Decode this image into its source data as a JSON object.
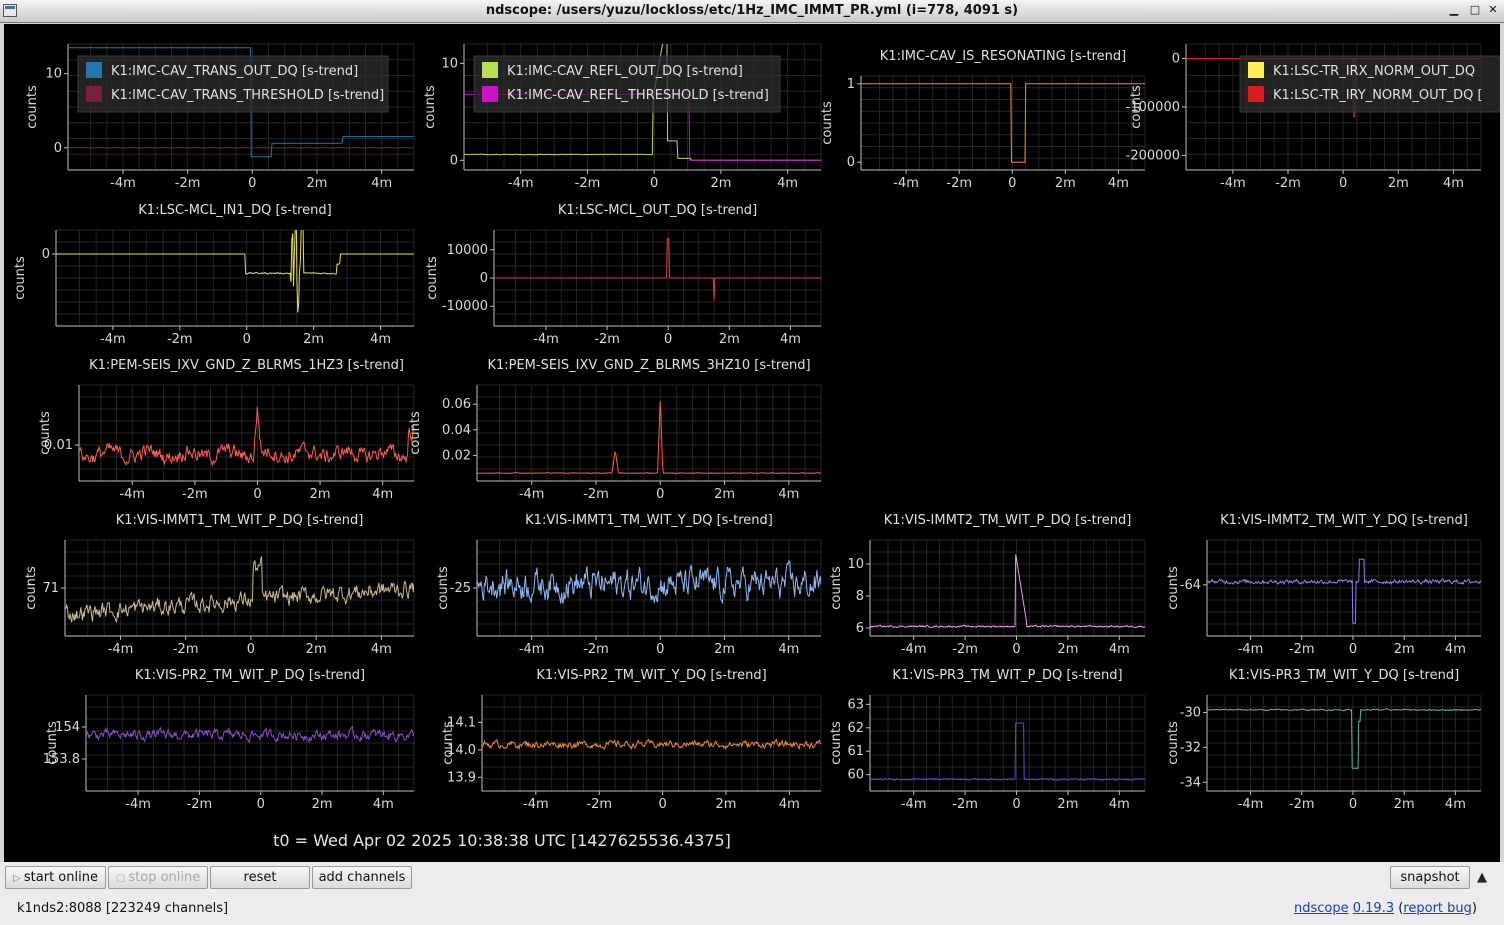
{
  "window": {
    "title": "ndscope: /users/yuzu/lockloss/etc/1Hz_IMC_IMMT_PR.yml (i=778, 4091 s)"
  },
  "t0_label": "t0 = Wed Apr 02 2025 10:38:38 UTC [1427625536.4375]",
  "toolbar": {
    "start_online": "start online",
    "stop_online": "stop online",
    "reset": "reset",
    "add_channels": "add channels",
    "snapshot": "snapshot"
  },
  "status": {
    "server": "k1nds2:8088   [223249 channels]",
    "app": "ndscope",
    "version": "0.19.3",
    "open": "(",
    "report": "report bug",
    "close": ")"
  },
  "x_ticks": [
    "-4m",
    "-2m",
    "0",
    "2m",
    "4m"
  ],
  "y_label": "counts",
  "plots": [
    {
      "id": "p00",
      "title": "",
      "ylim": [
        -3,
        14
      ],
      "yticks": [
        {
          "v": 0,
          "l": "0"
        },
        {
          "v": 10,
          "l": "10"
        }
      ],
      "legend": [
        {
          "label": "K1:IMC-CAV_TRANS_OUT_DQ [s-trend]",
          "color": "#1f77b4"
        },
        {
          "label": "K1:IMC-CAV_TRANS_THRESHOLD [s-trend]",
          "color": "#7b1e43"
        }
      ]
    },
    {
      "id": "p01",
      "title": "",
      "ylim": [
        -1,
        12
      ],
      "yticks": [
        {
          "v": 0,
          "l": "0"
        },
        {
          "v": 10,
          "l": "10"
        }
      ],
      "legend": [
        {
          "label": "K1:IMC-CAV_REFL_OUT_DQ [s-trend]",
          "color": "#b5e051"
        },
        {
          "label": "K1:IMC-CAV_REFL_THRESHOLD [s-trend]",
          "color": "#cc11cc"
        }
      ]
    },
    {
      "id": "p02",
      "title": "K1:IMC-CAV_IS_RESONATING [s-trend]",
      "ylim": [
        -0.1,
        1.1
      ],
      "yticks": [
        {
          "v": 0,
          "l": "0"
        },
        {
          "v": 1,
          "l": "1"
        }
      ],
      "legend": []
    },
    {
      "id": "p03",
      "title": "",
      "ylim": [
        -230000,
        30000
      ],
      "yticks": [
        {
          "v": 0,
          "l": "0"
        },
        {
          "v": -100000,
          "l": "-100000"
        },
        {
          "v": -200000,
          "l": "-200000"
        }
      ],
      "legend": [
        {
          "label": "K1:LSC-TR_IRX_NORM_OUT_DQ",
          "color": "#ffee55"
        },
        {
          "label": "K1:LSC-TR_IRY_NORM_OUT_DQ [",
          "color": "#e0191f"
        }
      ]
    },
    {
      "id": "p10",
      "title": "K1:LSC-MCL_IN1_DQ [s-trend]",
      "ylim": [
        -3,
        1
      ],
      "yticks": [
        {
          "v": 0,
          "l": "0"
        }
      ],
      "legend": []
    },
    {
      "id": "p11",
      "title": "K1:LSC-MCL_OUT_DQ [s-trend]",
      "ylim": [
        -17000,
        17000
      ],
      "yticks": [
        {
          "v": 10000,
          "l": "10000"
        },
        {
          "v": 0,
          "l": "0"
        },
        {
          "v": -10000,
          "l": "-10000"
        }
      ],
      "legend": []
    },
    {
      "id": "p20",
      "title": "K1:PEM-SEIS_IXV_GND_Z_BLRMS_1HZ3 [s-trend]",
      "ylim": [
        0.004,
        0.02
      ],
      "yticks": [
        {
          "v": 0.01,
          "l": "0.01"
        }
      ],
      "legend": []
    },
    {
      "id": "p21",
      "title": "K1:PEM-SEIS_IXV_GND_Z_BLRMS_3HZ10 [s-trend]",
      "ylim": [
        0,
        0.075
      ],
      "yticks": [
        {
          "v": 0.06,
          "l": "0.06"
        },
        {
          "v": 0.04,
          "l": "0.04"
        },
        {
          "v": 0.02,
          "l": "0.02"
        }
      ],
      "legend": []
    },
    {
      "id": "p30",
      "title": "K1:VIS-IMMT1_TM_WIT_P_DQ [s-trend]",
      "ylim": [
        70.4,
        71.6
      ],
      "yticks": [
        {
          "v": 71,
          "l": "71"
        }
      ],
      "legend": []
    },
    {
      "id": "p31",
      "title": "K1:VIS-IMMT1_TM_WIT_Y_DQ [s-trend]",
      "ylim": [
        -25.6,
        -24.4
      ],
      "yticks": [
        {
          "v": -25,
          "l": "-25"
        }
      ],
      "legend": []
    },
    {
      "id": "p32",
      "title": "K1:VIS-IMMT2_TM_WIT_P_DQ [s-trend]",
      "ylim": [
        5.5,
        11.5
      ],
      "yticks": [
        {
          "v": 10,
          "l": "10"
        },
        {
          "v": 8,
          "l": "8"
        },
        {
          "v": 6,
          "l": "6"
        }
      ],
      "legend": []
    },
    {
      "id": "p33",
      "title": "K1:VIS-IMMT2_TM_WIT_Y_DQ [s-trend]",
      "ylim": [
        -64.8,
        -63.3
      ],
      "yticks": [
        {
          "v": -64,
          "l": "-64"
        }
      ],
      "legend": []
    },
    {
      "id": "p40",
      "title": "K1:VIS-PR2_TM_WIT_P_DQ [s-trend]",
      "ylim": [
        153.6,
        154.2
      ],
      "yticks": [
        {
          "v": 154,
          "l": "154"
        },
        {
          "v": 153.8,
          "l": "153.8"
        }
      ],
      "legend": []
    },
    {
      "id": "p41",
      "title": "K1:VIS-PR2_TM_WIT_Y_DQ [s-trend]",
      "ylim": [
        13.85,
        14.2
      ],
      "yticks": [
        {
          "v": 14.1,
          "l": "14.1"
        },
        {
          "v": 14.0,
          "l": "14.0"
        },
        {
          "v": 13.9,
          "l": "13.9"
        }
      ],
      "legend": []
    },
    {
      "id": "p42",
      "title": "K1:VIS-PR3_TM_WIT_P_DQ [s-trend]",
      "ylim": [
        59.3,
        63.4
      ],
      "yticks": [
        {
          "v": 63,
          "l": "63"
        },
        {
          "v": 62,
          "l": "62"
        },
        {
          "v": 61,
          "l": "61"
        },
        {
          "v": 60,
          "l": "60"
        }
      ],
      "legend": []
    },
    {
      "id": "p43",
      "title": "K1:VIS-PR3_TM_WIT_Y_DQ [s-trend]",
      "ylim": [
        -34.5,
        -29
      ],
      "yticks": [
        {
          "v": -30,
          "l": "-30"
        },
        {
          "v": -32,
          "l": "-32"
        },
        {
          "v": -34,
          "l": "-34"
        }
      ],
      "legend": []
    }
  ]
}
